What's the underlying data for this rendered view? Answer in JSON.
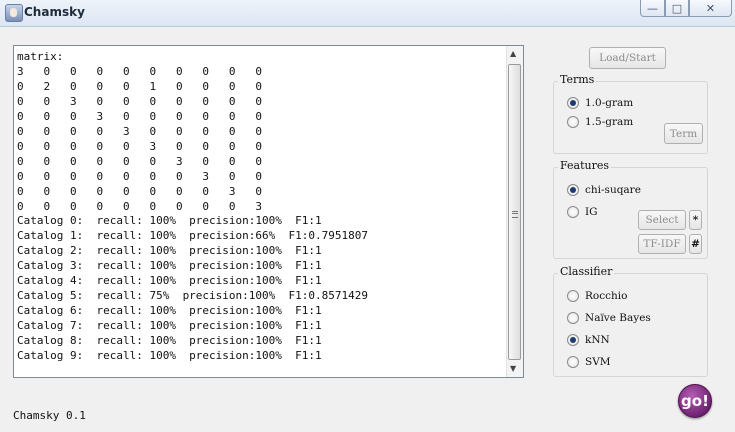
{
  "window": {
    "title": "Chamsky",
    "controls": {
      "minimize": "—",
      "maximize": "□",
      "close": "✕"
    }
  },
  "console": {
    "lines": [
      "matrix:",
      "3   0   0   0   0   0   0   0   0   0",
      "0   2   0   0   0   1   0   0   0   0",
      "0   0   3   0   0   0   0   0   0   0",
      "0   0   0   3   0   0   0   0   0   0",
      "0   0   0   0   3   0   0   0   0   0",
      "0   0   0   0   0   3   0   0   0   0",
      "0   0   0   0   0   0   3   0   0   0",
      "0   0   0   0   0   0   0   3   0   0",
      "0   0   0   0   0   0   0   0   3   0",
      "0   0   0   0   0   0   0   0   0   3",
      "Catalog 0:  recall: 100%  precision:100%  F1:1",
      "Catalog 1:  recall: 100%  precision:66%  F1:0.7951807",
      "Catalog 2:  recall: 100%  precision:100%  F1:1",
      "Catalog 3:  recall: 100%  precision:100%  F1:1",
      "Catalog 4:  recall: 100%  precision:100%  F1:1",
      "Catalog 5:  recall: 75%  precision:100%  F1:0.8571429",
      "Catalog 6:  recall: 100%  precision:100%  F1:1",
      "Catalog 7:  recall: 100%  precision:100%  F1:1",
      "Catalog 8:  recall: 100%  precision:100%  F1:1",
      "Catalog 9:  recall: 100%  precision:100%  F1:1"
    ]
  },
  "buttons": {
    "load_start": "Load/Start",
    "term": "Term",
    "select": "Select",
    "select_extra": "*",
    "tfidf": "TF-IDF",
    "tfidf_extra": "#",
    "go": "go!"
  },
  "terms": {
    "legend": "Terms",
    "options": [
      {
        "label": "1.0-gram",
        "selected": true
      },
      {
        "label": "1.5-gram",
        "selected": false
      }
    ]
  },
  "features": {
    "legend": "Features",
    "options": [
      {
        "label": "chi-suqare",
        "selected": true
      },
      {
        "label": "IG",
        "selected": false
      }
    ]
  },
  "classifier": {
    "legend": "Classifier",
    "options": [
      {
        "label": "Rocchio",
        "selected": false
      },
      {
        "label": "Naïve Bayes",
        "selected": false
      },
      {
        "label": "kNN",
        "selected": true
      },
      {
        "label": "SVM",
        "selected": false
      }
    ]
  },
  "status": "Chamsky 0.1",
  "icons": {
    "app": "app-portrait-icon",
    "scroll_up": "scroll-up-arrow-icon",
    "scroll_down": "scroll-down-arrow-icon",
    "go": "go-icon"
  }
}
